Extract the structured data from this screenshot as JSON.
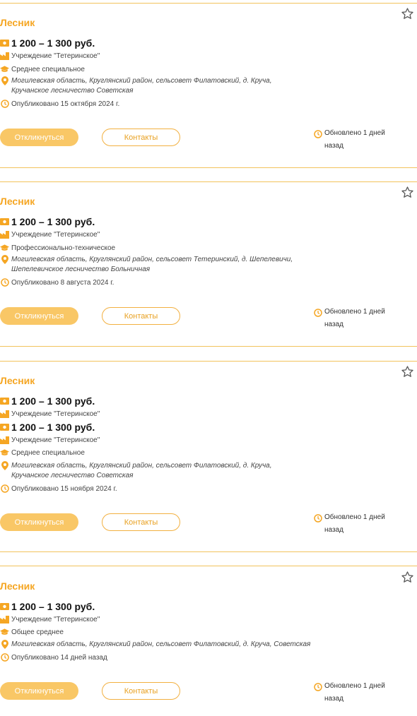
{
  "colors": {
    "accent": "#f5a623",
    "button_fill": "#f9c766",
    "separator": "#f2c35c"
  },
  "icons": [
    "money-icon",
    "factory-icon",
    "graduation-cap-icon",
    "location-pin-icon",
    "clock-icon",
    "star-icon"
  ],
  "cards": [
    {
      "title": "Лесник",
      "salary": "1 200 – 1 300 руб.",
      "employer": "Учреждение \"Тетеринское\"",
      "education": "Среднее специальное",
      "location": "Могилевская область, Круглянский район, сельсовет Филатовский, д. Круча, Кручанское лесничество Советская",
      "published": "Опубликовано 15 октября 2024 г.",
      "respond_label": "Откликнуться",
      "contacts_label": "Контакты",
      "updated": "Обновлено 1 дней назад"
    },
    {
      "title": "Лесник",
      "salary": "1 200 – 1 300 руб.",
      "employer": "Учреждение \"Тетеринское\"",
      "education": "Профессионально-техническое",
      "location": "Могилевская область, Круглянский район, сельсовет Тетеринский, д. Шепелевичи, Шепелевичское лесничество Больничная",
      "published": "Опубликовано 8 августа 2024 г.",
      "respond_label": "Откликнуться",
      "contacts_label": "Контакты",
      "updated": "Обновлено 1 дней назад"
    },
    {
      "title": "Лесник",
      "salary": "1 200 – 1 300 руб.",
      "employer": "Учреждение \"Тетеринское\"",
      "salary_dup": "1 200 – 1 300 руб.",
      "employer_dup": "Учреждение \"Тетеринское\"",
      "education": "Среднее специальное",
      "location": "Могилевская область, Круглянский район, сельсовет Филатовский, д. Круча, Кручанское лесничество Советская",
      "published": "Опубликовано 15 ноября 2024 г.",
      "respond_label": "Откликнуться",
      "contacts_label": "Контакты",
      "updated": "Обновлено 1 дней назад"
    },
    {
      "title": "Лесник",
      "salary": "1 200 – 1 300 руб.",
      "employer": "Учреждение \"Тетеринское\"",
      "education": "Общее среднее",
      "location": "Могилевская область, Круглянский район, сельсовет Филатовский, д. Круча, Советская",
      "published": "Опубликовано 14 дней назад",
      "respond_label": "Откликнуться",
      "contacts_label": "Контакты",
      "updated": "Обновлено 1 дней назад"
    }
  ]
}
